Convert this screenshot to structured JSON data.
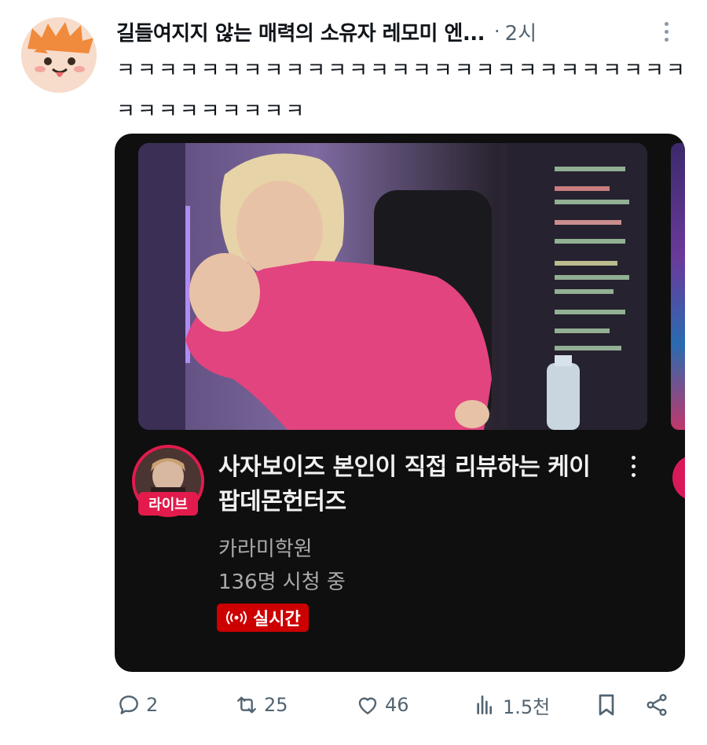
{
  "tweet": {
    "author": "길들여지지 않는 매력의 소유자 레모미 엔...",
    "separator": "·",
    "time": "2시",
    "text": "ㅋㅋㅋㅋㅋㅋㅋㅋㅋㅋㅋㅋㅋㅋㅋㅋㅋㅋㅋㅋㅋㅋㅋㅋㅋㅋㅋㅋㅋㅋㅋㅋㅋㅋㅋㅋ"
  },
  "card": {
    "live_badge": "라이브",
    "title": "사자보이즈 본인이 직접 리뷰하는 케이팝데몬헌터즈",
    "channel": "카라미학원",
    "viewers": "136명 시청 중",
    "live_label": "실시간",
    "live_icon": "broadcast-icon"
  },
  "actions": {
    "replies": "2",
    "retweets": "25",
    "likes": "46",
    "views": "1.5천"
  },
  "colors": {
    "card_bg": "#0f0f0f",
    "live_red": "#cc0000",
    "badge_red": "#e21b4c",
    "muted": "#536471"
  }
}
